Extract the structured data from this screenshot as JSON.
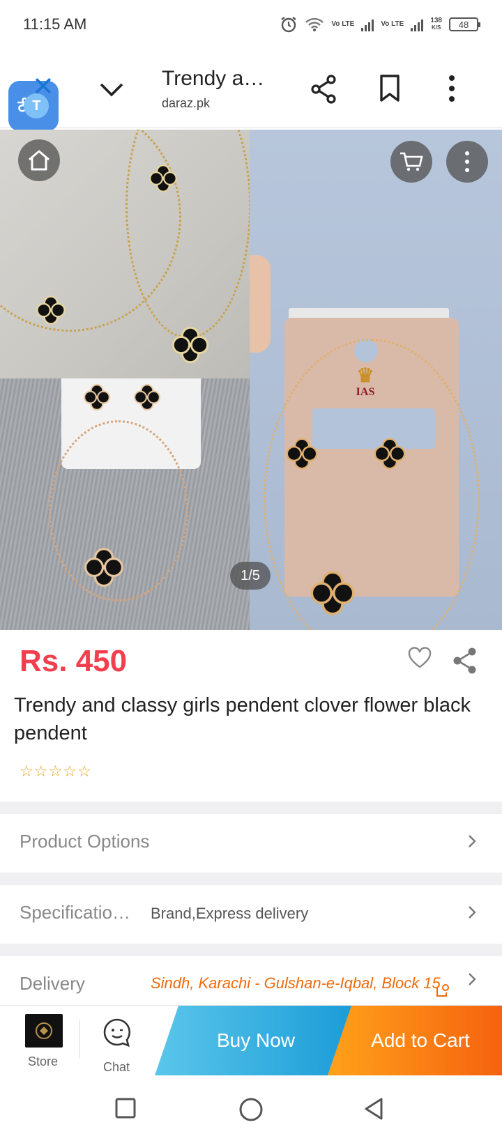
{
  "status_bar": {
    "time": "11:15 AM",
    "network_1": "Vo LTE",
    "network_2": "Vo LTE",
    "speed_value": "138",
    "speed_unit": "K/S",
    "battery": "48"
  },
  "browser": {
    "title": "Trendy a…",
    "domain": "daraz.pk",
    "translate_glyph_1": "टी",
    "translate_glyph_2": "T"
  },
  "gallery": {
    "counter": "1/5",
    "brand_logo": "IAS"
  },
  "product": {
    "price": "Rs. 450",
    "title": "Trendy and classy girls pendent clover flower black pendent",
    "rating_stars": 0
  },
  "rows": {
    "options_label": "Product Options",
    "spec_label": "Specificatio…",
    "spec_value": "Brand,Express delivery",
    "delivery_label": "Delivery",
    "delivery_value": "Sindh, Karachi - Gulshan-e-Iqbal, Block 15"
  },
  "action_bar": {
    "store_label": "Store",
    "chat_label": "Chat",
    "buy_now": "Buy Now",
    "add_to_cart": "Add to Cart"
  },
  "colors": {
    "price": "#f23f4e",
    "buy_now": "#1a9bd7",
    "add_to_cart": "#f5620f",
    "delivery_text": "#f06a0a"
  }
}
